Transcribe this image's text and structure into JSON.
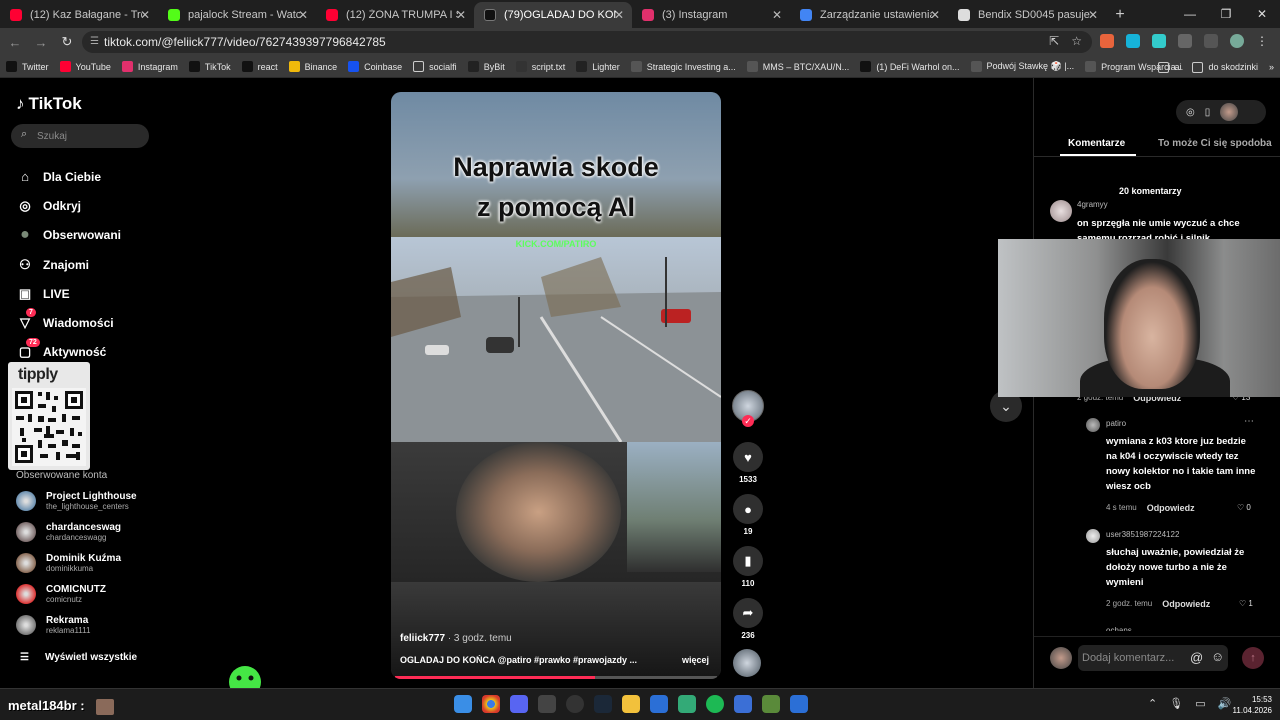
{
  "browser": {
    "tabs": [
      {
        "title": "(12) Kaz Bałagane - Trendsetter",
        "color": "#ff0033",
        "active": false
      },
      {
        "title": "pajalock Stream - Watch Live o",
        "color": "#53fc18",
        "active": false
      },
      {
        "title": "(12) ŻONA TRUMPA I SPOWIED",
        "color": "#ff0033",
        "active": false
      },
      {
        "title": "(79)OGLADAJ DO KOŃCA @",
        "color": "#ffffff",
        "active": true
      },
      {
        "title": "(3) Instagram",
        "color": "#e1306c",
        "active": false
      },
      {
        "title": "Zarządzanie ustawieniami trans",
        "color": "#4285f4",
        "active": false
      },
      {
        "title": "Bendix SD0045 pasuje do Octa",
        "color": "#ffffff",
        "active": false
      }
    ],
    "new_tab": "+",
    "url": "tiktok.com/@feliick777/video/7627439397796842785",
    "bookmarks": [
      {
        "label": "Twitter",
        "icon": "x-icon"
      },
      {
        "label": "YouTube",
        "icon": "youtube-icon"
      },
      {
        "label": "Instagram",
        "icon": "instagram-icon"
      },
      {
        "label": "TikTok",
        "icon": "tiktok-icon"
      },
      {
        "label": "react",
        "icon": "tiktok-icon"
      },
      {
        "label": "Binance",
        "icon": "binance-icon"
      },
      {
        "label": "Coinbase",
        "icon": "coinbase-icon"
      },
      {
        "label": "socialfi",
        "icon": "folder-icon"
      },
      {
        "label": "ByBit",
        "icon": "bybit-icon"
      },
      {
        "label": "script.txt",
        "icon": "github-icon"
      },
      {
        "label": "Lighter",
        "icon": "lighter-icon"
      },
      {
        "label": "Strategic Investing a...",
        "icon": "globe-icon"
      },
      {
        "label": "MMS – BTC/XAU/N...",
        "icon": "globe-icon"
      },
      {
        "label": "(1) DeFi Warhol on...",
        "icon": "x-icon"
      },
      {
        "label": "Podwój Stawkę 🎲 |...",
        "icon": "globe-icon"
      },
      {
        "label": "Program Wsparcia...",
        "icon": "globe-icon"
      }
    ],
    "bookmark_folders": [
      "ai",
      "do skodzinki"
    ]
  },
  "sidebar": {
    "logo": "TikTok",
    "search_placeholder": "Szukaj",
    "nav": [
      {
        "label": "Dla Ciebie",
        "icon": "home-icon",
        "badge": ""
      },
      {
        "label": "Odkryj",
        "icon": "compass-icon",
        "badge": ""
      },
      {
        "label": "Obserwowani",
        "icon": "following-avatar-icon",
        "badge": ""
      },
      {
        "label": "Znajomi",
        "icon": "friends-icon",
        "badge": ""
      },
      {
        "label": "LIVE",
        "icon": "live-icon",
        "badge": ""
      },
      {
        "label": "Wiadomości",
        "icon": "messages-icon",
        "badge": "7"
      },
      {
        "label": "Aktywność",
        "icon": "activity-icon",
        "badge": "72"
      }
    ],
    "qr_brand": "tipply",
    "followed_header": "Obserwowane konta",
    "accounts": [
      {
        "name": "Project Lighthouse",
        "handle": "the_lighthouse_centers",
        "color": "#6a8fb0"
      },
      {
        "name": "chardanceswag",
        "handle": "chardanceswagg",
        "color": "#7a6a6a"
      },
      {
        "name": "Dominik Kuźma",
        "handle": "dominikkuma",
        "color": "#8a6a55"
      },
      {
        "name": "COMICNUTZ",
        "handle": "comicnutz",
        "color": "#d33"
      },
      {
        "name": "Rekrama",
        "handle": "reklama1111",
        "color": "#777"
      }
    ],
    "show_all": "Wyświetl wszystkie"
  },
  "video": {
    "caption_line1": "Naprawia skode",
    "caption_line2": "z pomocą AI",
    "watermark": "KICK.COM/PATIRO",
    "author": "feliick777",
    "time": " · 3 godz. temu",
    "description": "OGLADAJ DO KOŃCA @patiro #prawko #prawojazdy ...",
    "more": "więcej",
    "progress": 0.62
  },
  "actions": {
    "likes": "1533",
    "comments": "19",
    "saves": "110",
    "shares": "236"
  },
  "panel": {
    "tab_comments": "Komentarze",
    "tab_related": "To może Ci się spodoba",
    "comment_count": "20 komentarzy",
    "comments": [
      {
        "user": "4gramyy",
        "text": "on sprzęgła nie umie wyczuć a chce samemu rozrząd robić i silnik"
      },
      {
        "user": "patiro",
        "text": "wymiana z k03 ktore juz bedzie na k04 i oczywiscie wtedy tez nowy kolektor no i takie tam inne wiesz ocb",
        "time": "4 s temu",
        "reply": "Odpowiedz",
        "likes": "0"
      },
      {
        "user": "user3851987224122",
        "text": "słuchaj uważnie, powiedział że dołoży nowe turbo a nie że wymieni",
        "time": "2 godz. temu",
        "reply": "Odpowiedz",
        "likes": "1"
      }
    ],
    "partial_meta": {
      "time": "2 godz. temu",
      "reply": "Odpowiedz",
      "likes": "13"
    },
    "partial_user": "ochans",
    "input_placeholder": "Dodaj komentarz..."
  },
  "taskbar": {
    "stream_label": "metal184br :",
    "time": "15:53",
    "date": "11.04.2026"
  }
}
